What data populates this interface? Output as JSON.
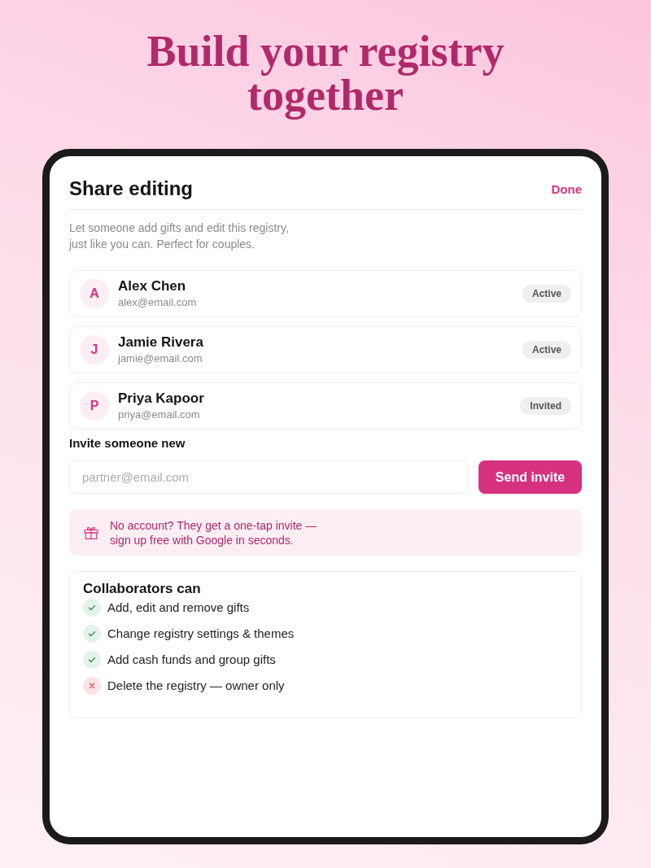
{
  "headline": "Build your registry together",
  "sheet": {
    "title": "Share editing",
    "done": "Done",
    "description": "Let someone add gifts and edit this registry, just like you can. Perfect for couples."
  },
  "members": [
    {
      "initial": "A",
      "name": "Alex Chen",
      "email": "alex@email.com",
      "status": "Active"
    },
    {
      "initial": "J",
      "name": "Jamie Rivera",
      "email": "jamie@email.com",
      "status": "Active"
    },
    {
      "initial": "P",
      "name": "Priya Kapoor",
      "email": "priya@email.com",
      "status": "Invited"
    }
  ],
  "invite": {
    "label": "Invite someone new",
    "placeholder": "partner@email.com",
    "button": "Send invite"
  },
  "notice": {
    "text": "No account? They get a one-tap invite — sign up free with Google in seconds."
  },
  "permissions": {
    "title": "Collaborators can",
    "items": [
      {
        "label": "Add, edit and remove gifts",
        "allowed": true
      },
      {
        "label": "Change registry settings & themes",
        "allowed": true
      },
      {
        "label": "Add cash funds and group gifts",
        "allowed": true
      },
      {
        "label": "Delete the registry — owner only",
        "allowed": false
      }
    ]
  }
}
